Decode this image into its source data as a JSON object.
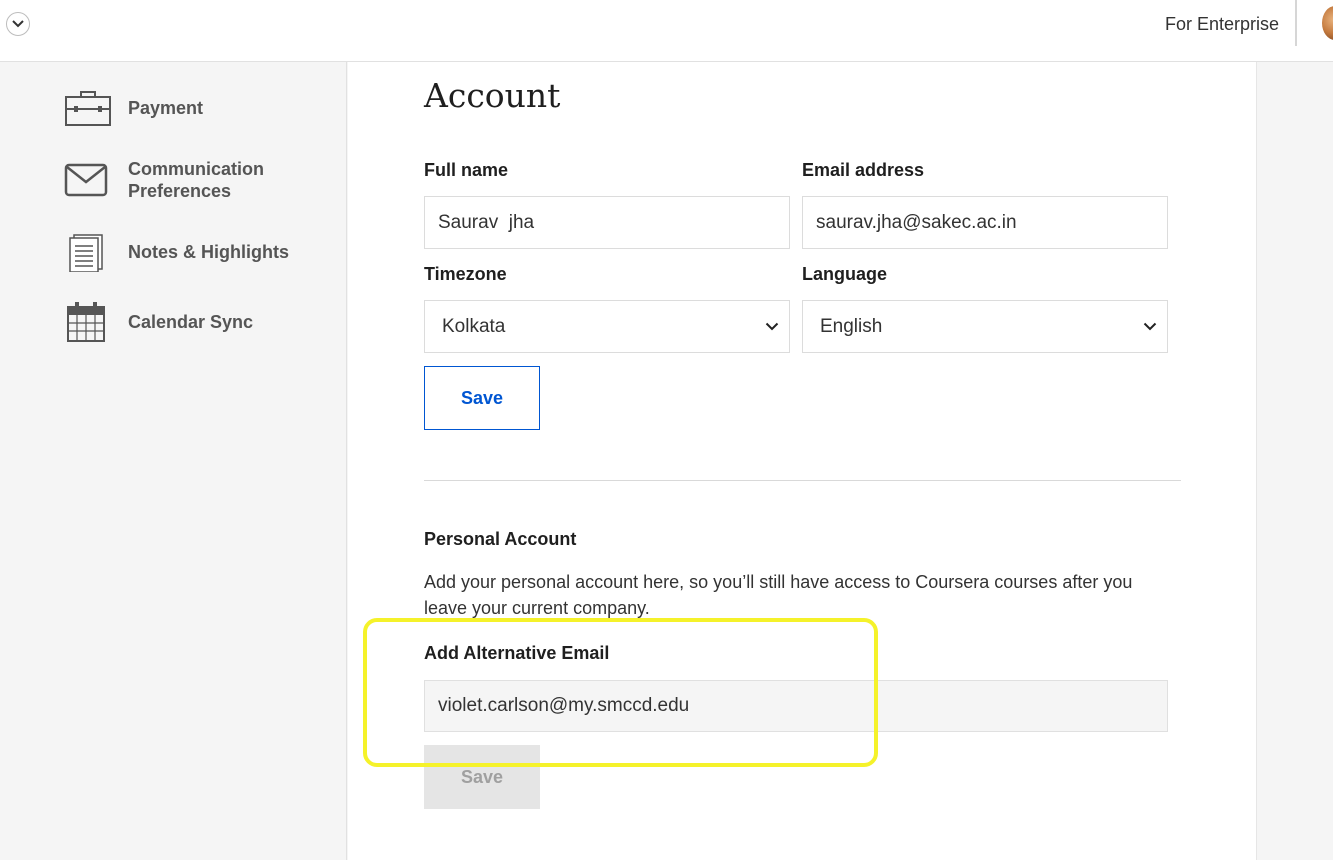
{
  "header": {
    "for_enterprise": "For Enterprise"
  },
  "sidebar": {
    "items": [
      {
        "label": "Payment",
        "icon": "briefcase-icon"
      },
      {
        "label": "Communication Preferences",
        "icon": "envelope-icon"
      },
      {
        "label": "Notes & Highlights",
        "icon": "notes-icon"
      },
      {
        "label": "Calendar Sync",
        "icon": "calendar-icon"
      }
    ]
  },
  "account": {
    "title": "Account",
    "full_name_label": "Full name",
    "full_name_value": "Saurav  jha",
    "email_label": "Email address",
    "email_value": "saurav.jha@sakec.ac.in",
    "timezone_label": "Timezone",
    "timezone_value": "Kolkata",
    "language_label": "Language",
    "language_value": "English",
    "save_label": "Save"
  },
  "personal_account": {
    "title": "Personal Account",
    "description": "Add your personal account here, so you’ll still have access to Coursera courses after you leave your current company.",
    "alt_email_label": "Add Alternative Email",
    "alt_email_value": "violet.carlson@my.smccd.edu",
    "save_label": "Save"
  },
  "colors": {
    "accent": "#0056d2",
    "highlight": "#f5f22a"
  }
}
